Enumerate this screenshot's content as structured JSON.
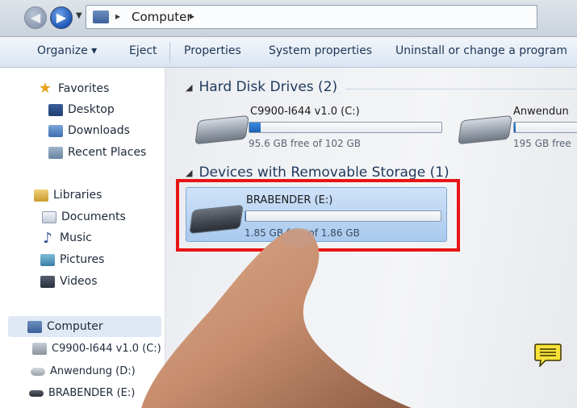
{
  "address": {
    "location": "Computer"
  },
  "toolbar": {
    "organize": "Organize ▾",
    "eject": "Eject",
    "properties": "Properties",
    "system_properties": "System properties",
    "uninstall": "Uninstall or change a program"
  },
  "navpane": {
    "favorites": "Favorites",
    "desktop": "Desktop",
    "downloads": "Downloads",
    "recent": "Recent Places",
    "libraries": "Libraries",
    "documents": "Documents",
    "music": "Music",
    "pictures": "Pictures",
    "videos": "Videos",
    "computer": "Computer",
    "drive_c": "C9900-I644 v1.0 (C:)",
    "drive_d": "Anwendung (D:)",
    "drive_e": "BRABENDER (E:)"
  },
  "content": {
    "hard_disks_header": "Hard Disk Drives (2)",
    "removable_header": "Devices with Removable Storage (1)",
    "drives": [
      {
        "name": "C9900-I644 v1.0 (C:)",
        "free": "95.6 GB free of 102 GB",
        "used_fraction": 0.06
      },
      {
        "name": "Anwendun",
        "free": "195 GB free",
        "used_fraction": 0.02
      }
    ],
    "removable": {
      "name": "BRABENDER (E:)",
      "free": "1.85 GB free of 1.86 GB",
      "used_fraction": 0.005
    }
  },
  "colors": {
    "highlight": "#e81515",
    "selection": "#a9c9ee",
    "bar_fill": "#1b5fb6"
  }
}
